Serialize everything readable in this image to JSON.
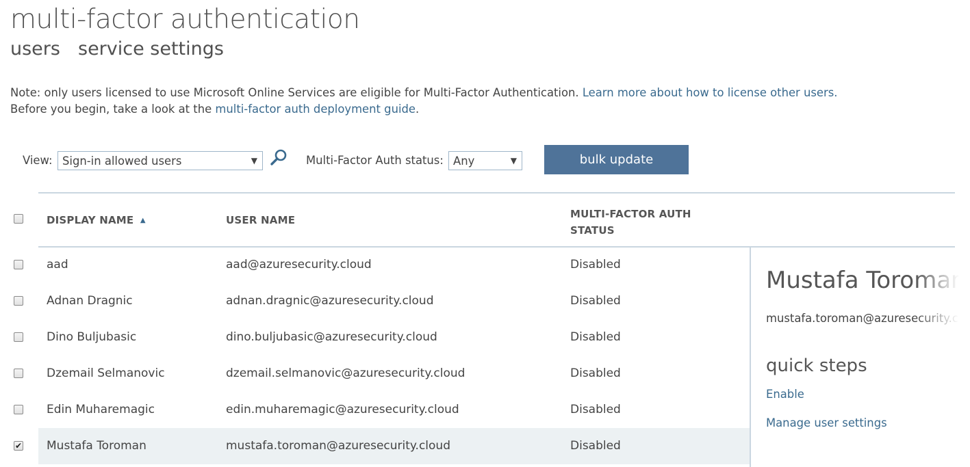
{
  "page": {
    "title": "multi-factor authentication",
    "tabs": [
      "users",
      "service settings"
    ]
  },
  "notes": {
    "line1_text": "Note: only users licensed to use Microsoft Online Services are eligible for Multi-Factor Authentication.",
    "line1_link": "Learn more about how to license other users.",
    "line2_text": "Before you begin, take a look at the",
    "line2_link": "multi-factor auth deployment guide",
    "line2_end": "."
  },
  "filters": {
    "view_label": "View:",
    "view_value": "Sign-in allowed users",
    "search_icon": "search-icon",
    "status_label": "Multi-Factor Auth status:",
    "status_value": "Any",
    "bulk_update_label": "bulk update"
  },
  "table": {
    "columns": [
      "DISPLAY NAME",
      "USER NAME",
      "MULTI-FACTOR AUTH",
      "STATUS"
    ],
    "sort_icon": "sort-ascending-icon",
    "rows": [
      {
        "display_name": "aad",
        "user_name": "aad@azuresecurity.cloud",
        "status": "Disabled",
        "checked": false
      },
      {
        "display_name": "Adnan Dragnic",
        "user_name": "adnan.dragnic@azuresecurity.cloud",
        "status": "Disabled",
        "checked": false
      },
      {
        "display_name": "Dino Buljubasic",
        "user_name": "dino.buljubasic@azuresecurity.cloud",
        "status": "Disabled",
        "checked": false
      },
      {
        "display_name": "Dzemail Selmanovic",
        "user_name": "dzemail.selmanovic@azuresecurity.cloud",
        "status": "Disabled",
        "checked": false
      },
      {
        "display_name": "Edin Muharemagic",
        "user_name": "edin.muharemagic@azuresecurity.cloud",
        "status": "Disabled",
        "checked": false
      },
      {
        "display_name": "Mustafa Toroman",
        "user_name": "mustafa.toroman@azuresecurity.cloud",
        "status": "Disabled",
        "checked": true
      }
    ]
  },
  "panel": {
    "name": "Mustafa Toroman",
    "email": "mustafa.toroman@azuresecurity.cloud",
    "quick_steps_title": "quick steps",
    "enable_label": "Enable",
    "manage_label": "Manage user settings"
  },
  "colors": {
    "accent_button": "#4f7399",
    "link": "#3a6a8e",
    "selected_row": "#ecf1f3",
    "divider": "#c9d6e0"
  }
}
